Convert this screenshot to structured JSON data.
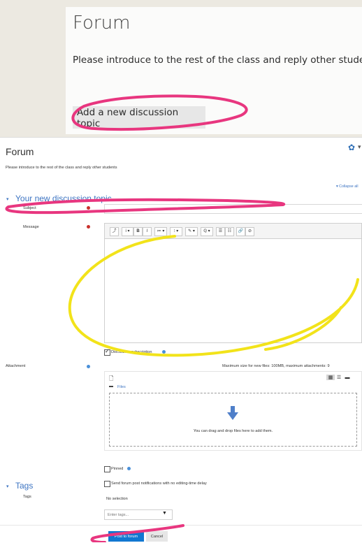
{
  "top": {
    "title": "Forum",
    "intro": "Please introduce to the rest of the class and reply other students",
    "add_button": "Add a new discussion topic"
  },
  "form": {
    "title": "Forum",
    "intro": "Please introduce to the rest of the class and reply other students",
    "collapse_all": "Collapse all",
    "section_discussion": "Your new discussion topic",
    "subject_label": "Subject",
    "message_label": "Message",
    "toolbar": [
      "⤴",
      "i ▾",
      "B",
      "I",
      "≔ ▾",
      "⁝ ▾",
      "✎ ▾",
      "ℚ ▾",
      "☰",
      "☷",
      "🔗",
      "⊘"
    ],
    "discussion_subscription": "Discussion subscription",
    "attachment_label": "Attachment",
    "max_size": "Maximum size for new files: 100MB, maximum attachments: 9",
    "files_folder": "Files",
    "drop_text": "You can drag and drop files here to add them.",
    "pinned": "Pinned",
    "send_notifications": "Send forum post notifications with no editing-time delay",
    "section_tags": "Tags",
    "tags_label": "Tags",
    "no_selection": "No selection",
    "tags_placeholder": "Enter tags...",
    "post_button": "Post to forum",
    "cancel_button": "Cancel"
  },
  "colors": {
    "accent": "#3d74c2",
    "primary_button": "#1177d1",
    "annotation_pink": "#e8367f",
    "annotation_yellow": "#f2e31a"
  }
}
